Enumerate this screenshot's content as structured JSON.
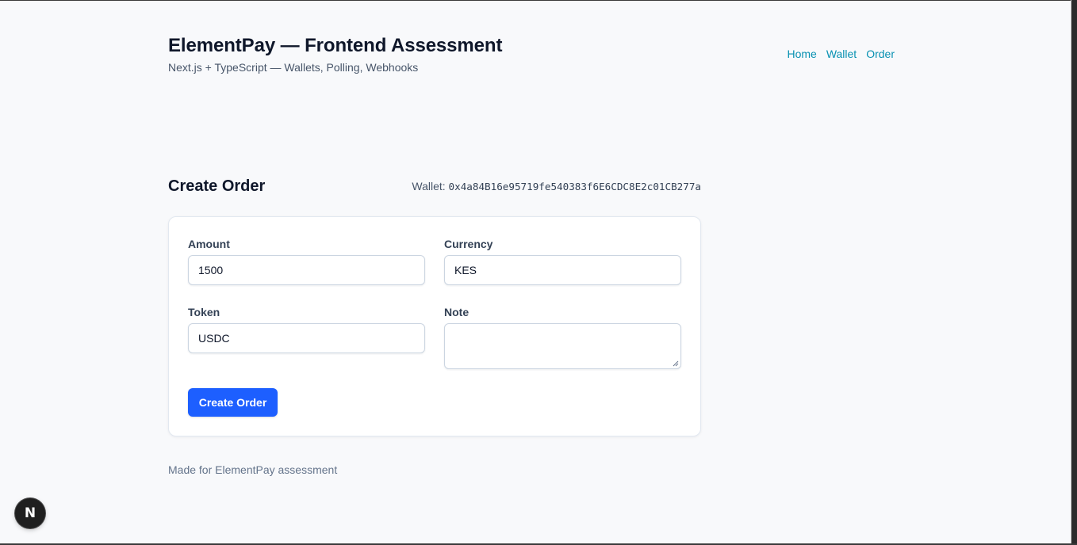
{
  "header": {
    "title": "ElementPay — Frontend Assessment",
    "subtitle": "Next.js + TypeScript — Wallets, Polling, Webhooks",
    "nav": [
      "Home",
      "Wallet",
      "Order"
    ]
  },
  "section": {
    "title": "Create Order",
    "wallet_label": "Wallet:",
    "wallet_address": "0x4a84B16e95719fe540383f6E6CDC8E2c01CB277a"
  },
  "form": {
    "amount": {
      "label": "Amount",
      "value": "1500"
    },
    "currency": {
      "label": "Currency",
      "value": "KES"
    },
    "token": {
      "label": "Token",
      "value": "USDC"
    },
    "note": {
      "label": "Note",
      "value": ""
    },
    "submit_label": "Create Order"
  },
  "footer": {
    "text": "Made for ElementPay assessment"
  },
  "dev_indicator": {
    "letter": "N",
    "icon": "nextjs-icon"
  },
  "colors": {
    "background": "#f8f9fb",
    "primary_button": "#1d5fff",
    "nav_link": "#0891b2"
  }
}
